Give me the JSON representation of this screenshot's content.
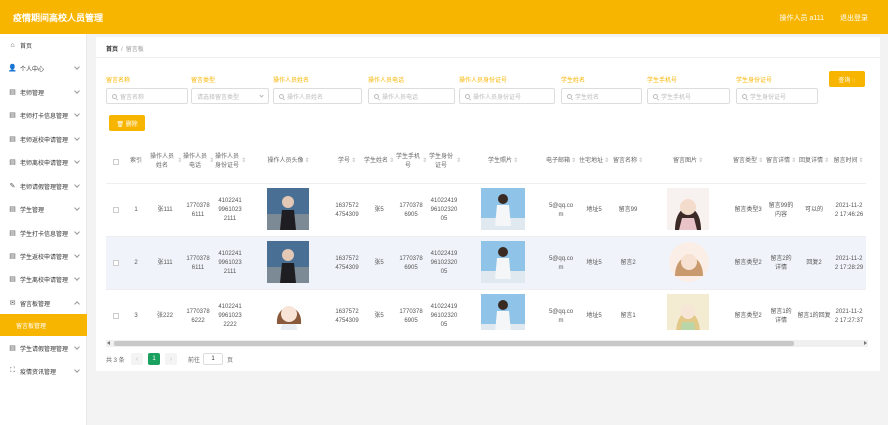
{
  "header": {
    "title": "疫情期间高校人员管理",
    "user": "操作人员 a111",
    "logout": "退出登录"
  },
  "sidebar": {
    "items": [
      {
        "label": "首页",
        "icon": "home-icon"
      },
      {
        "label": "个人中心",
        "icon": "user-icon"
      },
      {
        "label": "老师管理",
        "icon": "doc-icon"
      },
      {
        "label": "老师打卡信息管理",
        "icon": "doc-icon"
      },
      {
        "label": "老师返校申请管理",
        "icon": "doc-icon"
      },
      {
        "label": "老师离校申请管理",
        "icon": "doc-icon"
      },
      {
        "label": "老师请假管理管理",
        "icon": "edit-icon"
      },
      {
        "label": "学生管理",
        "icon": "doc-icon"
      },
      {
        "label": "学生打卡信息管理",
        "icon": "doc-icon"
      },
      {
        "label": "学生返校申请管理",
        "icon": "doc-icon"
      },
      {
        "label": "学生离校申请管理",
        "icon": "doc-icon"
      },
      {
        "label": "留言板管理",
        "icon": "mail-icon"
      },
      {
        "label": "留言板管理",
        "icon": ""
      },
      {
        "label": "学生请假管理管理",
        "icon": "doc-icon"
      },
      {
        "label": "疫情资讯管理",
        "icon": "expand-icon"
      }
    ]
  },
  "breadcrumb": {
    "home": "首页",
    "sep": "/",
    "current": "留言板"
  },
  "filters": [
    {
      "label": "留言名称",
      "placeholder": "留言名称"
    },
    {
      "label": "留言类型",
      "placeholder": "请选择留言类型"
    },
    {
      "label": "操作人员姓名",
      "placeholder": "操作人员姓名"
    },
    {
      "label": "操作人员电话",
      "placeholder": "操作人员电话"
    },
    {
      "label": "操作人员身份证号",
      "placeholder": "操作人员身份证号"
    },
    {
      "label": "学生姓名",
      "placeholder": "学生姓名"
    },
    {
      "label": "学生手机号",
      "placeholder": "学生手机号"
    },
    {
      "label": "学生身份证号",
      "placeholder": "学生身份证号"
    }
  ],
  "buttons": {
    "search": "查询 ◌",
    "delete": "🗑 删除"
  },
  "table": {
    "headers": [
      "索引",
      "操作人员姓名",
      "操作人员电话",
      "操作人员身份证号",
      "操作人员头像",
      "学号",
      "学生姓名",
      "学生手机号",
      "学生身份证号",
      "学生照片",
      "电子邮箱",
      "住宅地址",
      "留言名称",
      "留言图片",
      "留言类型",
      "留言详情",
      "回复详情",
      "留言时间"
    ],
    "rows": [
      {
        "idx": "1",
        "opname": "张111",
        "opphone": "17703786111",
        "opid": "410224199610232111",
        "sno": "16375724754309",
        "sname": "张5",
        "sphone": "17703786905",
        "sid": "410224199610232005",
        "email": "5@qq.com",
        "addr": "地址5",
        "mname": "留言99",
        "mtype": "留言类型3",
        "mdetail": "留言99的内容",
        "reply": "可以的",
        "mtime": "2021-11-22 17:46:26"
      },
      {
        "idx": "2",
        "opname": "张111",
        "opphone": "17703786111",
        "opid": "410224199610232111",
        "sno": "16375724754309",
        "sname": "张5",
        "sphone": "17703786905",
        "sid": "410224199610232005",
        "email": "5@qq.com",
        "addr": "地址5",
        "mname": "留言2",
        "mtype": "留言类型2",
        "mdetail": "留言2的详情",
        "reply": "回复2",
        "mtime": "2021-11-22 17:28:29"
      },
      {
        "idx": "3",
        "opname": "张222",
        "opphone": "17703786222",
        "opid": "410224199610232222",
        "sno": "16375724754309",
        "sname": "张5",
        "sphone": "17703786905",
        "sid": "410224199610232005",
        "email": "5@qq.com",
        "addr": "地址5",
        "mname": "留言1",
        "mtype": "留言类型2",
        "mdetail": "留言1的详情",
        "reply": "留言1的回复",
        "mtime": "2021-11-22 17:27:37"
      }
    ]
  },
  "pagination": {
    "total": "共 3 条",
    "prev": "‹",
    "page": "1",
    "next": "›",
    "goto": "前往",
    "input": "1",
    "unit": "页"
  },
  "colors": {
    "accent": "#f7b500",
    "page_active": "#1aa15f"
  }
}
